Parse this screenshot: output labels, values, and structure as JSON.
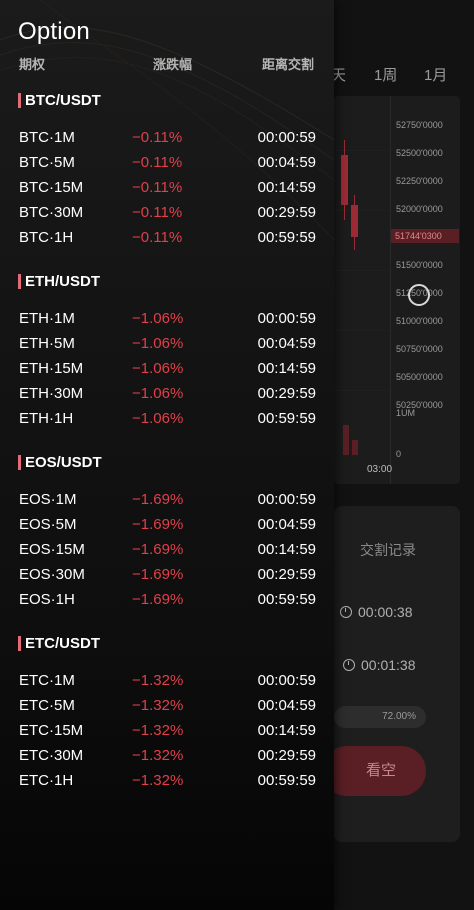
{
  "background": {
    "timeframes": [
      "天",
      "1周",
      "1月"
    ],
    "price_ticks": [
      "52750'0000",
      "52500'0000",
      "52250'0000",
      "52000'0000",
      "51744'0300",
      "51500'0000",
      "51250'0000",
      "51000'0000",
      "50750'0000",
      "50500'0000",
      "50250'0000"
    ],
    "current_price": "51744'0300",
    "volume_label": "1UM",
    "volume_zero": "0",
    "time_label": "03:00",
    "trade_records_label": "交割记录",
    "timers": [
      "00:00:38",
      "00:01:38"
    ],
    "progress": "72.00%",
    "see_button": "看空"
  },
  "drawer": {
    "title": "Option",
    "headers": {
      "col1": "期权",
      "col2": "涨跌幅",
      "col3": "距离交割"
    },
    "sections": [
      {
        "title": "BTC/USDT",
        "rows": [
          {
            "name": "BTC·1M",
            "change": "−0.11%",
            "time": "00:00:59"
          },
          {
            "name": "BTC·5M",
            "change": "−0.11%",
            "time": "00:04:59"
          },
          {
            "name": "BTC·15M",
            "change": "−0.11%",
            "time": "00:14:59"
          },
          {
            "name": "BTC·30M",
            "change": "−0.11%",
            "time": "00:29:59"
          },
          {
            "name": "BTC·1H",
            "change": "−0.11%",
            "time": "00:59:59"
          }
        ]
      },
      {
        "title": "ETH/USDT",
        "rows": [
          {
            "name": "ETH·1M",
            "change": "−1.06%",
            "time": "00:00:59"
          },
          {
            "name": "ETH·5M",
            "change": "−1.06%",
            "time": "00:04:59"
          },
          {
            "name": "ETH·15M",
            "change": "−1.06%",
            "time": "00:14:59"
          },
          {
            "name": "ETH·30M",
            "change": "−1.06%",
            "time": "00:29:59"
          },
          {
            "name": "ETH·1H",
            "change": "−1.06%",
            "time": "00:59:59"
          }
        ]
      },
      {
        "title": "EOS/USDT",
        "rows": [
          {
            "name": "EOS·1M",
            "change": "−1.69%",
            "time": "00:00:59"
          },
          {
            "name": "EOS·5M",
            "change": "−1.69%",
            "time": "00:04:59"
          },
          {
            "name": "EOS·15M",
            "change": "−1.69%",
            "time": "00:14:59"
          },
          {
            "name": "EOS·30M",
            "change": "−1.69%",
            "time": "00:29:59"
          },
          {
            "name": "EOS·1H",
            "change": "−1.69%",
            "time": "00:59:59"
          }
        ]
      },
      {
        "title": "ETC/USDT",
        "rows": [
          {
            "name": "ETC·1M",
            "change": "−1.32%",
            "time": "00:00:59"
          },
          {
            "name": "ETC·5M",
            "change": "−1.32%",
            "time": "00:04:59"
          },
          {
            "name": "ETC·15M",
            "change": "−1.32%",
            "time": "00:14:59"
          },
          {
            "name": "ETC·30M",
            "change": "−1.32%",
            "time": "00:29:59"
          },
          {
            "name": "ETC·1H",
            "change": "−1.32%",
            "time": "00:59:59"
          }
        ]
      }
    ]
  }
}
